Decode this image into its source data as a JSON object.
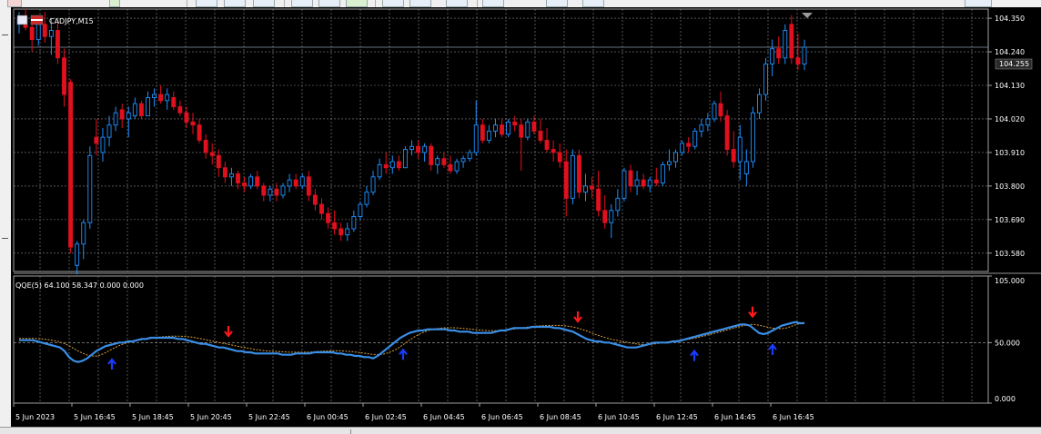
{
  "price_panel": {
    "symbol_label": "CADJPY,M15",
    "current_price_label": "104.255",
    "current_price": 104.255,
    "price_axis_labels": [
      "104.350",
      "104.240",
      "104.130",
      "104.020",
      "103.910",
      "103.800",
      "103.690",
      "103.580"
    ],
    "colors": {
      "bull": "#1e90ff",
      "bear": "#e0101e",
      "grid": "#8a8a8a",
      "background": "#000000"
    }
  },
  "indicator_panel": {
    "label": "QQE(5) 64.100 58.347 0.000 0.000",
    "axis_labels": [
      "105.000",
      "50.000",
      "0.000"
    ],
    "colors": {
      "rsi_line": "#3a8ee6",
      "trailing_line": "#d9a040",
      "buy_arrow": "#1a3cff",
      "sell_arrow": "#ff1a1a"
    }
  },
  "time_axis_labels": [
    "5 Jun 2023",
    "5 Jun 16:45",
    "5 Jun 18:45",
    "5 Jun 20:45",
    "5 Jun 22:45",
    "6 Jun 00:45",
    "6 Jun 02:45",
    "6 Jun 04:45",
    "6 Jun 06:45",
    "6 Jun 08:45",
    "6 Jun 10:45",
    "6 Jun 12:45",
    "6 Jun 14:45",
    "6 Jun 16:45"
  ],
  "chart_data": {
    "type": "candlestick",
    "symbol": "CADJPY",
    "timeframe": "M15",
    "ylim": [
      103.52,
      104.38
    ],
    "candles": [
      {
        "o": 104.33,
        "h": 104.37,
        "l": 104.3,
        "c": 104.35
      },
      {
        "o": 104.35,
        "h": 104.38,
        "l": 104.31,
        "c": 104.32
      },
      {
        "o": 104.32,
        "h": 104.35,
        "l": 104.24,
        "c": 104.28
      },
      {
        "o": 104.28,
        "h": 104.36,
        "l": 104.26,
        "c": 104.33
      },
      {
        "o": 104.33,
        "h": 104.37,
        "l": 104.27,
        "c": 104.29
      },
      {
        "o": 104.29,
        "h": 104.35,
        "l": 104.23,
        "c": 104.31
      },
      {
        "o": 104.31,
        "h": 104.34,
        "l": 104.2,
        "c": 104.22
      },
      {
        "o": 104.22,
        "h": 104.25,
        "l": 104.06,
        "c": 104.1
      },
      {
        "o": 104.14,
        "h": 104.15,
        "l": 103.58,
        "c": 103.6
      },
      {
        "o": 103.54,
        "h": 103.62,
        "l": 103.51,
        "c": 103.61
      },
      {
        "o": 103.61,
        "h": 103.69,
        "l": 103.56,
        "c": 103.68
      },
      {
        "o": 103.68,
        "h": 103.93,
        "l": 103.66,
        "c": 103.9
      },
      {
        "o": 103.96,
        "h": 104.02,
        "l": 103.9,
        "c": 103.94
      },
      {
        "o": 103.91,
        "h": 103.99,
        "l": 103.88,
        "c": 103.96
      },
      {
        "o": 103.96,
        "h": 104.03,
        "l": 103.93,
        "c": 104.0
      },
      {
        "o": 104.0,
        "h": 104.06,
        "l": 103.98,
        "c": 104.04
      },
      {
        "o": 104.05,
        "h": 104.07,
        "l": 103.99,
        "c": 104.02
      },
      {
        "o": 104.02,
        "h": 104.06,
        "l": 103.96,
        "c": 104.04
      },
      {
        "o": 104.03,
        "h": 104.09,
        "l": 104.02,
        "c": 104.07
      },
      {
        "o": 104.07,
        "h": 104.08,
        "l": 104.02,
        "c": 104.03
      },
      {
        "o": 104.03,
        "h": 104.11,
        "l": 104.03,
        "c": 104.09
      },
      {
        "o": 104.09,
        "h": 104.12,
        "l": 104.06,
        "c": 104.1
      },
      {
        "o": 104.1,
        "h": 104.13,
        "l": 104.07,
        "c": 104.08
      },
      {
        "o": 104.08,
        "h": 104.12,
        "l": 104.05,
        "c": 104.1
      },
      {
        "o": 104.09,
        "h": 104.11,
        "l": 104.05,
        "c": 104.06
      },
      {
        "o": 104.06,
        "h": 104.08,
        "l": 104.03,
        "c": 104.04
      },
      {
        "o": 104.04,
        "h": 104.06,
        "l": 103.99,
        "c": 104.01
      },
      {
        "o": 104.01,
        "h": 104.04,
        "l": 103.97,
        "c": 104.0
      },
      {
        "o": 104.0,
        "h": 104.02,
        "l": 103.94,
        "c": 103.95
      },
      {
        "o": 103.95,
        "h": 103.97,
        "l": 103.89,
        "c": 103.91
      },
      {
        "o": 103.91,
        "h": 103.94,
        "l": 103.87,
        "c": 103.9
      },
      {
        "o": 103.9,
        "h": 103.92,
        "l": 103.83,
        "c": 103.86
      },
      {
        "o": 103.86,
        "h": 103.88,
        "l": 103.81,
        "c": 103.83
      },
      {
        "o": 103.83,
        "h": 103.86,
        "l": 103.8,
        "c": 103.84
      },
      {
        "o": 103.84,
        "h": 103.85,
        "l": 103.79,
        "c": 103.81
      },
      {
        "o": 103.81,
        "h": 103.83,
        "l": 103.78,
        "c": 103.8
      },
      {
        "o": 103.8,
        "h": 103.84,
        "l": 103.79,
        "c": 103.83
      },
      {
        "o": 103.83,
        "h": 103.85,
        "l": 103.79,
        "c": 103.8
      },
      {
        "o": 103.8,
        "h": 103.81,
        "l": 103.75,
        "c": 103.77
      },
      {
        "o": 103.77,
        "h": 103.8,
        "l": 103.75,
        "c": 103.79
      },
      {
        "o": 103.79,
        "h": 103.81,
        "l": 103.75,
        "c": 103.77
      },
      {
        "o": 103.77,
        "h": 103.81,
        "l": 103.76,
        "c": 103.8
      },
      {
        "o": 103.8,
        "h": 103.84,
        "l": 103.78,
        "c": 103.82
      },
      {
        "o": 103.82,
        "h": 103.84,
        "l": 103.79,
        "c": 103.8
      },
      {
        "o": 103.8,
        "h": 103.84,
        "l": 103.79,
        "c": 103.83
      },
      {
        "o": 103.83,
        "h": 103.85,
        "l": 103.75,
        "c": 103.77
      },
      {
        "o": 103.77,
        "h": 103.79,
        "l": 103.72,
        "c": 103.74
      },
      {
        "o": 103.74,
        "h": 103.76,
        "l": 103.69,
        "c": 103.71
      },
      {
        "o": 103.71,
        "h": 103.73,
        "l": 103.66,
        "c": 103.68
      },
      {
        "o": 103.68,
        "h": 103.72,
        "l": 103.64,
        "c": 103.66
      },
      {
        "o": 103.66,
        "h": 103.68,
        "l": 103.62,
        "c": 103.64
      },
      {
        "o": 103.64,
        "h": 103.68,
        "l": 103.62,
        "c": 103.66
      },
      {
        "o": 103.66,
        "h": 103.72,
        "l": 103.65,
        "c": 103.7
      },
      {
        "o": 103.7,
        "h": 103.75,
        "l": 103.69,
        "c": 103.74
      },
      {
        "o": 103.74,
        "h": 103.8,
        "l": 103.73,
        "c": 103.78
      },
      {
        "o": 103.78,
        "h": 103.85,
        "l": 103.77,
        "c": 103.83
      },
      {
        "o": 103.83,
        "h": 103.89,
        "l": 103.82,
        "c": 103.87
      },
      {
        "o": 103.87,
        "h": 103.91,
        "l": 103.84,
        "c": 103.86
      },
      {
        "o": 103.86,
        "h": 103.9,
        "l": 103.84,
        "c": 103.88
      },
      {
        "o": 103.88,
        "h": 103.9,
        "l": 103.85,
        "c": 103.86
      },
      {
        "o": 103.86,
        "h": 103.93,
        "l": 103.86,
        "c": 103.92
      },
      {
        "o": 103.92,
        "h": 103.95,
        "l": 103.9,
        "c": 103.93
      },
      {
        "o": 103.93,
        "h": 103.95,
        "l": 103.89,
        "c": 103.91
      },
      {
        "o": 103.91,
        "h": 103.94,
        "l": 103.88,
        "c": 103.93
      },
      {
        "o": 103.93,
        "h": 103.94,
        "l": 103.85,
        "c": 103.87
      },
      {
        "o": 103.87,
        "h": 103.9,
        "l": 103.84,
        "c": 103.89
      },
      {
        "o": 103.89,
        "h": 103.91,
        "l": 103.86,
        "c": 103.87
      },
      {
        "o": 103.87,
        "h": 103.9,
        "l": 103.84,
        "c": 103.85
      },
      {
        "o": 103.85,
        "h": 103.89,
        "l": 103.84,
        "c": 103.88
      },
      {
        "o": 103.88,
        "h": 103.9,
        "l": 103.86,
        "c": 103.89
      },
      {
        "o": 103.89,
        "h": 103.92,
        "l": 103.88,
        "c": 103.91
      },
      {
        "o": 103.91,
        "h": 104.08,
        "l": 103.9,
        "c": 104.0
      },
      {
        "o": 104.0,
        "h": 104.02,
        "l": 103.94,
        "c": 103.95
      },
      {
        "o": 103.95,
        "h": 104.0,
        "l": 103.94,
        "c": 103.98
      },
      {
        "o": 103.98,
        "h": 104.02,
        "l": 103.96,
        "c": 104.0
      },
      {
        "o": 104.0,
        "h": 104.02,
        "l": 103.96,
        "c": 103.97
      },
      {
        "o": 103.97,
        "h": 104.02,
        "l": 103.96,
        "c": 104.01
      },
      {
        "o": 104.01,
        "h": 104.03,
        "l": 103.98,
        "c": 104.0
      },
      {
        "o": 104.0,
        "h": 104.02,
        "l": 103.85,
        "c": 103.96
      },
      {
        "o": 103.96,
        "h": 104.02,
        "l": 103.95,
        "c": 104.01
      },
      {
        "o": 104.01,
        "h": 104.03,
        "l": 103.97,
        "c": 103.98
      },
      {
        "o": 103.98,
        "h": 104.02,
        "l": 103.94,
        "c": 103.95
      },
      {
        "o": 103.95,
        "h": 103.99,
        "l": 103.91,
        "c": 103.92
      },
      {
        "o": 103.92,
        "h": 103.95,
        "l": 103.88,
        "c": 103.91
      },
      {
        "o": 103.91,
        "h": 103.94,
        "l": 103.86,
        "c": 103.88
      },
      {
        "o": 103.88,
        "h": 103.92,
        "l": 103.7,
        "c": 103.76
      },
      {
        "o": 103.76,
        "h": 103.92,
        "l": 103.74,
        "c": 103.9
      },
      {
        "o": 103.9,
        "h": 103.92,
        "l": 103.76,
        "c": 103.78
      },
      {
        "o": 103.78,
        "h": 103.84,
        "l": 103.75,
        "c": 103.8
      },
      {
        "o": 103.8,
        "h": 103.83,
        "l": 103.76,
        "c": 103.79
      },
      {
        "o": 103.79,
        "h": 103.85,
        "l": 103.7,
        "c": 103.72
      },
      {
        "o": 103.72,
        "h": 103.77,
        "l": 103.66,
        "c": 103.68
      },
      {
        "o": 103.68,
        "h": 103.74,
        "l": 103.63,
        "c": 103.72
      },
      {
        "o": 103.72,
        "h": 103.79,
        "l": 103.7,
        "c": 103.76
      },
      {
        "o": 103.76,
        "h": 103.86,
        "l": 103.75,
        "c": 103.85
      },
      {
        "o": 103.85,
        "h": 103.87,
        "l": 103.78,
        "c": 103.8
      },
      {
        "o": 103.8,
        "h": 103.85,
        "l": 103.77,
        "c": 103.82
      },
      {
        "o": 103.82,
        "h": 103.84,
        "l": 103.79,
        "c": 103.8
      },
      {
        "o": 103.8,
        "h": 103.83,
        "l": 103.78,
        "c": 103.82
      },
      {
        "o": 103.82,
        "h": 103.86,
        "l": 103.8,
        "c": 103.81
      },
      {
        "o": 103.81,
        "h": 103.88,
        "l": 103.8,
        "c": 103.87
      },
      {
        "o": 103.87,
        "h": 103.92,
        "l": 103.85,
        "c": 103.88
      },
      {
        "o": 103.88,
        "h": 103.92,
        "l": 103.86,
        "c": 103.91
      },
      {
        "o": 103.91,
        "h": 103.95,
        "l": 103.9,
        "c": 103.94
      },
      {
        "o": 103.94,
        "h": 103.96,
        "l": 103.91,
        "c": 103.93
      },
      {
        "o": 103.93,
        "h": 103.99,
        "l": 103.92,
        "c": 103.98
      },
      {
        "o": 103.98,
        "h": 104.02,
        "l": 103.96,
        "c": 104.0
      },
      {
        "o": 104.0,
        "h": 104.04,
        "l": 103.98,
        "c": 104.02
      },
      {
        "o": 104.02,
        "h": 104.08,
        "l": 104.01,
        "c": 104.07
      },
      {
        "o": 104.07,
        "h": 104.11,
        "l": 104.01,
        "c": 104.03
      },
      {
        "o": 104.03,
        "h": 104.05,
        "l": 103.9,
        "c": 103.92
      },
      {
        "o": 103.92,
        "h": 103.98,
        "l": 103.86,
        "c": 103.88
      },
      {
        "o": 103.88,
        "h": 104.0,
        "l": 103.82,
        "c": 103.96
      },
      {
        "o": 103.84,
        "h": 103.92,
        "l": 103.8,
        "c": 103.88
      },
      {
        "o": 103.88,
        "h": 104.06,
        "l": 103.86,
        "c": 104.04
      },
      {
        "o": 104.04,
        "h": 104.12,
        "l": 104.02,
        "c": 104.1
      },
      {
        "o": 104.1,
        "h": 104.22,
        "l": 104.08,
        "c": 104.2
      },
      {
        "o": 104.2,
        "h": 104.28,
        "l": 104.16,
        "c": 104.25
      },
      {
        "o": 104.25,
        "h": 104.29,
        "l": 104.2,
        "c": 104.22
      },
      {
        "o": 104.22,
        "h": 104.33,
        "l": 104.2,
        "c": 104.31
      },
      {
        "o": 104.33,
        "h": 104.36,
        "l": 104.2,
        "c": 104.22
      },
      {
        "o": 104.22,
        "h": 104.3,
        "l": 104.18,
        "c": 104.2
      },
      {
        "o": 104.2,
        "h": 104.28,
        "l": 104.18,
        "c": 104.255
      }
    ],
    "indicator": {
      "name": "QQE(5)",
      "values_printed": [
        64.1,
        58.347,
        0.0,
        0.0
      ],
      "ylim": [
        0,
        105
      ],
      "level": 50,
      "rsi_line": [
        52,
        52,
        52,
        52,
        51,
        50,
        49,
        48,
        47,
        46,
        43,
        38,
        35,
        34,
        35,
        37,
        40,
        43,
        45,
        47,
        48,
        49,
        50,
        50,
        51,
        51,
        52,
        53,
        53,
        54,
        54,
        54,
        54,
        54,
        54,
        53,
        53,
        52,
        51,
        50,
        49,
        49,
        48,
        47,
        46,
        46,
        45,
        44,
        43,
        43,
        42,
        42,
        41,
        41,
        41,
        41,
        41,
        41,
        40,
        40,
        40,
        41,
        41,
        41,
        41,
        42,
        42,
        42,
        42,
        42,
        41,
        41,
        40,
        40,
        39,
        39,
        38,
        38,
        37,
        39,
        42,
        45,
        48,
        51,
        54,
        56,
        58,
        59,
        60,
        60,
        61,
        61,
        61,
        61,
        61,
        60,
        60,
        59,
        59,
        59,
        58,
        58,
        58,
        58,
        58,
        59,
        60,
        60,
        61,
        62,
        62,
        62,
        62,
        63,
        63,
        63,
        63,
        63,
        62,
        62,
        61,
        60,
        59,
        57,
        55,
        53,
        52,
        51,
        51,
        50,
        50,
        49,
        48,
        47,
        46,
        46,
        46,
        47,
        48,
        49,
        50,
        50,
        50,
        50,
        51,
        51,
        52,
        53,
        54,
        55,
        56,
        57,
        58,
        59,
        60,
        61,
        62,
        63,
        64,
        65,
        65,
        64,
        61,
        58,
        57,
        58,
        60,
        62,
        64,
        65,
        66,
        67,
        66,
        66
      ]
    },
    "signals": [
      {
        "type": "buy",
        "time": "5 Jun 16:45"
      },
      {
        "type": "sell",
        "time": "5 Jun 20:45"
      },
      {
        "type": "buy",
        "time": "6 Jun 02:45"
      },
      {
        "type": "sell",
        "time": "6 Jun 08:45"
      },
      {
        "type": "buy",
        "time": "6 Jun 12:45"
      },
      {
        "type": "sell",
        "time": "6 Jun 14:45"
      },
      {
        "type": "buy",
        "time": "6 Jun 14:45"
      }
    ]
  }
}
